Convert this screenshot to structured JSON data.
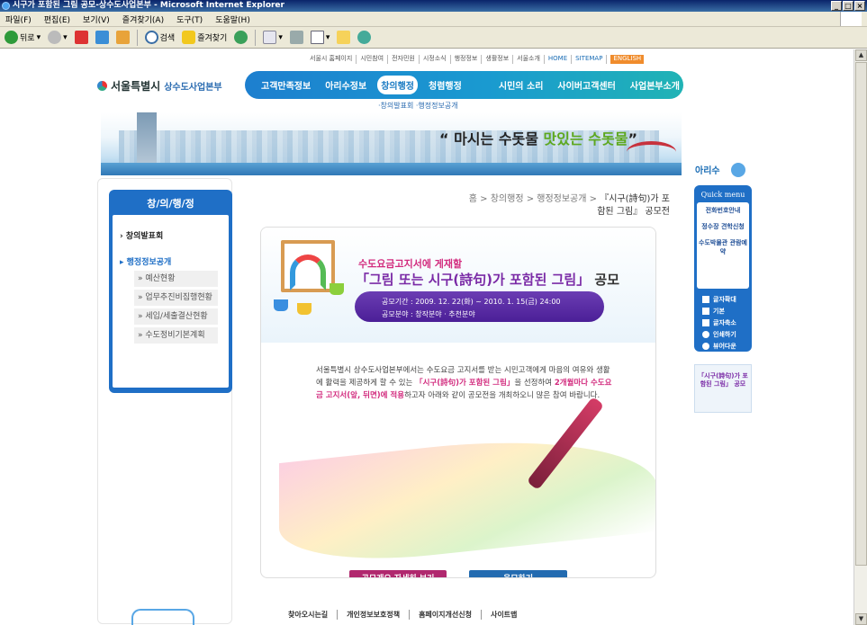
{
  "window": {
    "title": "시구가 포함된 그림 공모-상수도사업본부 - Microsoft Internet Explorer"
  },
  "menubar": [
    "파일(F)",
    "편집(E)",
    "보기(V)",
    "즐겨찾기(A)",
    "도구(T)",
    "도움말(H)"
  ],
  "toolbar": {
    "back": "뒤로",
    "search": "검색",
    "favorites": "즐겨찾기"
  },
  "util_links": [
    "서울시 홈페이지",
    "시민참여",
    "전자민원",
    "시정소식",
    "행정정보",
    "생활정보",
    "서울소개",
    "HOME",
    "SITEMAP",
    "ENGLISH"
  ],
  "logo": {
    "name": "서울특별시",
    "sub": "상수도사업본부"
  },
  "gnav": [
    "고객만족정보",
    "아리수정보",
    "창의행정",
    "청렴행정",
    "시민의 소리",
    "사이버고객센터",
    "사업본부소개"
  ],
  "subnav": "·창의발표회   ·행정정보공개",
  "banner": {
    "slogan_a": "“ 마시는 수돗물 ",
    "slogan_b": "맛있는 수돗물",
    "slogan_c": "”"
  },
  "lnav": {
    "title": "창/의/행/정",
    "items": [
      "창의발표회",
      "행정정보공개"
    ],
    "sub_items": [
      "예산현황",
      "업무추진비집행현황",
      "세입/세출결산현황",
      "수도정비기본계획"
    ]
  },
  "breadcrumb": {
    "path": "홈 > 창의행정 > 행정정보공개 > ",
    "current": "『시구(詩句)가 포함된 그림』 공모전"
  },
  "content": {
    "headline": "수도요금고지서에 게재할",
    "title": "「그림 또는 시구(詩句)가 포함된 그림」",
    "title_suffix": " 공모",
    "period": "공모기간 : 2009. 12. 22(화) ~ 2010. 1. 15(금) 24:00",
    "category": "공모분야 : 창작분야 · 추천분야",
    "body_1": "서울특별시 상수도사업본부에서는 수도요금 고지서를 받는 시민고객에게 마음의 여유와 생활에 활력을 제공하게 할 수 있는 ",
    "body_highlight_1": "「시구(詩句)가 포함된 그림」",
    "body_2": "을 선정하여 ",
    "body_highlight_2": "2개월마다 수도요금 고지서(앞, 뒤면)에 적용",
    "body_3": "하고자 아래와 같이 공모전을 개최하오니 많은 참여 바랍니다.",
    "btn_detail": "공모개요 자세히 보기",
    "btn_apply": "응모하기"
  },
  "quick": {
    "brand": "아리수",
    "title": "Quick menu",
    "items": [
      "전화번호안내",
      "정수장 견학신청",
      "수도박물관 관람예약"
    ],
    "tools": [
      "글자확대",
      "기본",
      "글자축소",
      "인쇄하기",
      "뷰어다운"
    ],
    "promo": "「시구(詩句)가 포함된 그림」 공모"
  },
  "footer": [
    "찾아오시는길",
    "개인정보보호정책",
    "홈페이지개선신청",
    "사이트맵"
  ],
  "colors": {
    "gnav": "#1d7fcf",
    "accent_pink": "#d22b7e",
    "accent_purple": "#7a2aa6",
    "btn_apply": "#236bb0"
  }
}
